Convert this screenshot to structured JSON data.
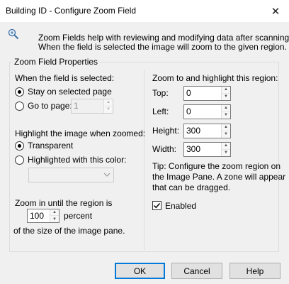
{
  "window": {
    "title": "Building ID - Configure Zoom Field",
    "close_glyph": "✕"
  },
  "info": {
    "icon": "magnifier-icon",
    "line1": "Zoom Fields help with reviewing and modifying data after scanning.",
    "line2": "When the field is selected the image will zoom to the given region."
  },
  "group": {
    "legend": "Zoom Field Properties"
  },
  "when_selected": {
    "label": "When the field is selected:",
    "option_stay": "Stay on selected page",
    "option_goto": "Go to page:",
    "selected": "stay",
    "page_value": "1"
  },
  "highlight": {
    "label": "Highlight the image when zoomed:",
    "option_transparent": "Transparent",
    "option_color": "Highlighted with this color:",
    "selected": "transparent",
    "color_value": ""
  },
  "zoom": {
    "line1": "Zoom in until the region is",
    "percent_value": "100",
    "percent_label": "percent",
    "line3": "of the size of the image pane."
  },
  "region": {
    "label": "Zoom to and highlight this region:",
    "top_label": "Top:",
    "top_value": "0",
    "left_label": "Left:",
    "left_value": "0",
    "height_label": "Height:",
    "height_value": "300",
    "width_label": "Width:",
    "width_value": "300"
  },
  "tip": {
    "line1": "Tip: Configure the zoom region on",
    "line2": "the Image Pane. A zone will appear",
    "line3": "that can be dragged."
  },
  "enabled": {
    "label": "Enabled",
    "checked": true
  },
  "buttons": {
    "ok": "OK",
    "cancel": "Cancel",
    "help": "Help"
  }
}
